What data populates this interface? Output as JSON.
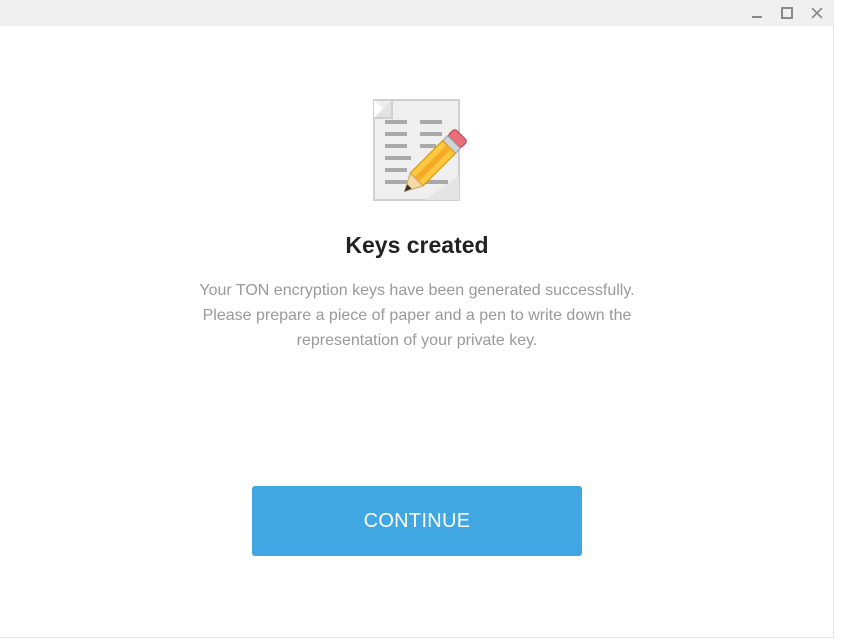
{
  "window": {
    "controls": {
      "minimize_icon": "minimize-icon",
      "maximize_icon": "maximize-icon",
      "close_icon": "close-icon"
    }
  },
  "main": {
    "illustration_icon": "document-pencil-icon",
    "title": "Keys created",
    "description_lines": [
      "Your TON encryption keys have been generated successfully.",
      "Please prepare a piece of paper and a pen to write down the",
      "representation of your private key."
    ],
    "continue_label": "CONTINUE"
  },
  "colors": {
    "accent": "#40a7e3",
    "title_text": "#222222",
    "body_text": "#999999",
    "titlebar_bg": "#f0f0f0"
  }
}
